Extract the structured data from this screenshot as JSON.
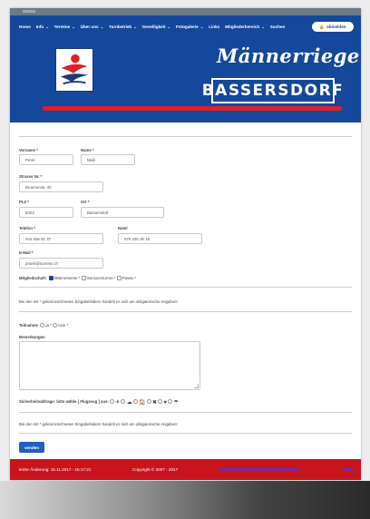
{
  "nav": {
    "items": [
      {
        "label": "Home",
        "has_dropdown": false
      },
      {
        "label": "Info",
        "has_dropdown": true
      },
      {
        "label": "Termine",
        "has_dropdown": true
      },
      {
        "label": "Über uns",
        "has_dropdown": true
      },
      {
        "label": "Turnbetrieb",
        "has_dropdown": true
      },
      {
        "label": "Geselligkeit",
        "has_dropdown": true
      },
      {
        "label": "Fotogalerie",
        "has_dropdown": true
      },
      {
        "label": "Links",
        "has_dropdown": false
      },
      {
        "label": "Mitgliederbereich",
        "has_dropdown": true
      },
      {
        "label": "Suchen",
        "has_dropdown": false
      }
    ],
    "logout_label": "abmelden"
  },
  "brand": {
    "script": "Männerriege",
    "name": "BASSERSDORF",
    "colors": {
      "header_bg": "#15489a",
      "accent_red": "#e01f26",
      "footer_bg": "#c9141c"
    }
  },
  "form": {
    "vorname_label": "Vorname *",
    "vorname_value": "Peter",
    "name_label": "Name *",
    "name_value": "Meili",
    "strasse_label": "Strasse Nr. *",
    "strasse_value": "Brunnenstr. 40",
    "plz_label": "PLZ *",
    "plz_value": "8303",
    "ort_label": "Ort *",
    "ort_value": "Bassersdorf",
    "telefon_label": "Telefon *",
    "telefon_value": "044 836 81 37",
    "natel_label": "Natel",
    "natel_value": "079 330 30 16",
    "email_label": "E-Mail *",
    "email_value": "pmeili@sunrise.ch",
    "mitgliedschaft_label": "Mitgliedschaft:",
    "mitgliedschaft_options": [
      {
        "label": "Männerturner *",
        "checked": true
      },
      {
        "label": "Seniorenturner *",
        "checked": false
      },
      {
        "label": "Passiv *",
        "checked": false
      }
    ],
    "required_note": "Bei den mit * gekennzeichneten Eingabefeldern handelt es sich um obligatorische Angaben!",
    "teilnahme_label": "Teilnahme",
    "teilnahme_options": [
      {
        "label": "ja *"
      },
      {
        "label": "nein *"
      }
    ],
    "bemerkungen_label": "Bemerkungen",
    "captcha_label": "Sicherheitsabfrage: bitte wähle [ Flugzeug ] aus:",
    "captcha_icons": [
      "✈",
      "☁",
      "🏠",
      "✖",
      "♥",
      "☂"
    ],
    "required_note_2": "Bei den mit * gekennzeichneten Eingabefeldern handelt es sich um obligatorische Angaben!",
    "submit_label": "senden"
  },
  "footer": {
    "last_change": "letzte Änderung: 15.11.2017 - 15:17:21",
    "copyright": "Copyright © 2007 - 2017"
  }
}
